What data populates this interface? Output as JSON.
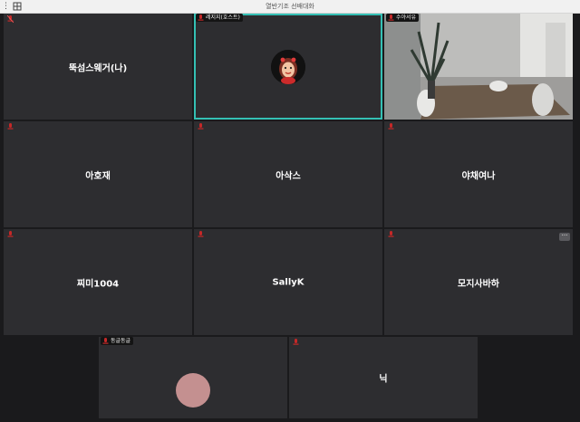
{
  "window": {
    "title": "열반기조 선배대화",
    "menu_icon": "kebab-menu-icon",
    "layout_icon": "grid-layout-icon"
  },
  "colors": {
    "tile_bg": "#2d2d30",
    "active_border": "#34c0b4",
    "muted_mic": "#c62828",
    "avatar_pink": "#c49090"
  },
  "participants": [
    {
      "name": "뚝섬스웨거(나)",
      "label": "",
      "mic": "muted-mic-icon"
    },
    {
      "name": "",
      "label": "레지지(호스트)",
      "mic": "muted-mic-icon",
      "video": "profile-avatar",
      "active_speaker": true
    },
    {
      "name": "",
      "label": "수야서유",
      "mic": "muted-mic-icon",
      "video": "camera-feed-room"
    },
    {
      "name": "아호재",
      "label": "",
      "mic": "muted-mic-icon"
    },
    {
      "name": "아삭스",
      "label": "",
      "mic": "muted-mic-icon"
    },
    {
      "name": "야채여나",
      "label": "",
      "mic": "muted-mic-icon"
    },
    {
      "name": "찌미1004",
      "label": "",
      "mic": "muted-mic-icon"
    },
    {
      "name": "SallyK",
      "label": "",
      "mic": "muted-mic-icon"
    },
    {
      "name": "모지사바하",
      "label": "",
      "mic": "muted-mic-icon",
      "more_button": "···"
    },
    {
      "name": "",
      "label": "동글동글",
      "mic": "muted-mic-icon",
      "video": "pink-circle-avatar"
    },
    {
      "name": "닉",
      "label": "",
      "mic": "muted-mic-icon"
    }
  ]
}
